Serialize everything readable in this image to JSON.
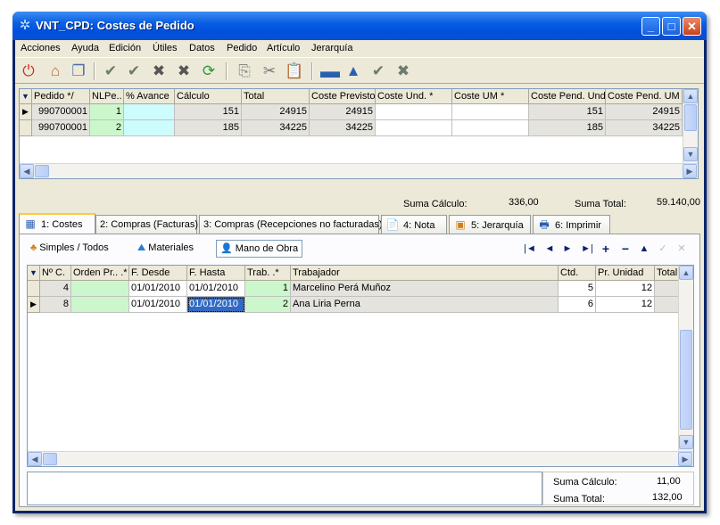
{
  "window": {
    "title": "VNT_CPD: Costes de Pedido",
    "min": "_",
    "max": "□",
    "close": "✕"
  },
  "menu": [
    "Acciones",
    "Ayuda",
    "Edición",
    "Útiles",
    "Datos",
    "Pedido",
    "Artículo",
    "Jerarquía"
  ],
  "toolbar_icons": [
    "power-icon",
    "home-icon",
    "windows-icon",
    "check-batch-icon",
    "check-batch-2-icon",
    "cancel-batch-icon",
    "cancel-batch-2-icon",
    "refresh-icon",
    "copy-icon",
    "cut-icon",
    "paste-icon",
    "minus-icon",
    "up-icon",
    "check-icon",
    "cancel-icon"
  ],
  "orders": {
    "headers": [
      "Pedido */",
      "NLPe..",
      "% Avance",
      "Cálculo",
      "Total",
      "Coste Previsto",
      "Coste Und. *",
      "Coste UM *",
      "Coste Pend. Und",
      "Coste Pend. UM"
    ],
    "rows": [
      [
        "990700001",
        "1",
        "",
        "151",
        "24915",
        "24915",
        "",
        "",
        "151",
        "24915"
      ],
      [
        "990700001",
        "2",
        "",
        "185",
        "34225",
        "34225",
        "",
        "",
        "185",
        "34225"
      ]
    ],
    "suma_calculo_label": "Suma Cálculo:",
    "suma_calculo": "336,00",
    "suma_total_label": "Suma Total:",
    "suma_total": "59.140,00"
  },
  "tabs": [
    "1: Costes",
    "2: Compras (Facturas)",
    "3: Compras (Recepciones no facturadas)",
    "4: Nota",
    "5: Jerarquía",
    "6: Imprimir"
  ],
  "subtabs": [
    "Simples / Todos",
    "Materiales",
    "Mano de Obra"
  ],
  "nav": [
    "|◄",
    "◄",
    "►",
    "►|",
    "+",
    "−",
    "▲",
    "✓",
    "✕"
  ],
  "labor": {
    "headers": [
      "Nº C.",
      "Orden Pr.. .*",
      "F. Desde",
      "F. Hasta",
      "Trab. .*",
      "Trabajador",
      "Ctd.",
      "Pr. Unidad",
      "Total"
    ],
    "rows": [
      [
        "4",
        "",
        "01/01/2010",
        "01/01/2010",
        "1",
        "Marcelino Perá Muñoz",
        "5",
        "12",
        ""
      ],
      [
        "8",
        "",
        "01/01/2010",
        "01/01/2010",
        "2",
        "Ana Liria Perna",
        "6",
        "12",
        ""
      ]
    ],
    "suma_calculo_label": "Suma Cálculo:",
    "suma_calculo": "11,00",
    "suma_total_label": "Suma Total:",
    "suma_total": "132,00"
  },
  "colors": {
    "title_blue": "#0050de",
    "green_cell": "#ccf7cc",
    "cyan_cell": "#ccfcfc",
    "selected": "#316ac5"
  }
}
